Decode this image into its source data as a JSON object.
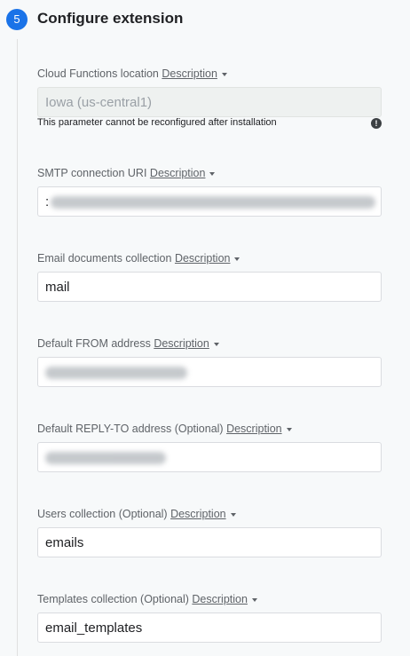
{
  "step": {
    "number": "5",
    "title": "Configure extension"
  },
  "description_link": "Description",
  "fields": [
    {
      "label": "Cloud Functions location",
      "value": "Iowa (us-central1)",
      "disabled": true,
      "note": "This parameter cannot be reconfigured after installation",
      "note_icon": "info-icon"
    },
    {
      "label": "SMTP connection URI",
      "value": ":",
      "redacted": true
    },
    {
      "label": "Email documents collection",
      "value": "mail"
    },
    {
      "label": "Default FROM address",
      "value": "",
      "redacted": true
    },
    {
      "label": "Default REPLY-TO address (Optional)",
      "value": "",
      "redacted": true
    },
    {
      "label": "Users collection (Optional)",
      "value": "emails"
    },
    {
      "label": "Templates collection (Optional)",
      "value": "email_templates"
    }
  ],
  "colors": {
    "accent": "#1a73e8",
    "background": "#f7f9fa"
  }
}
